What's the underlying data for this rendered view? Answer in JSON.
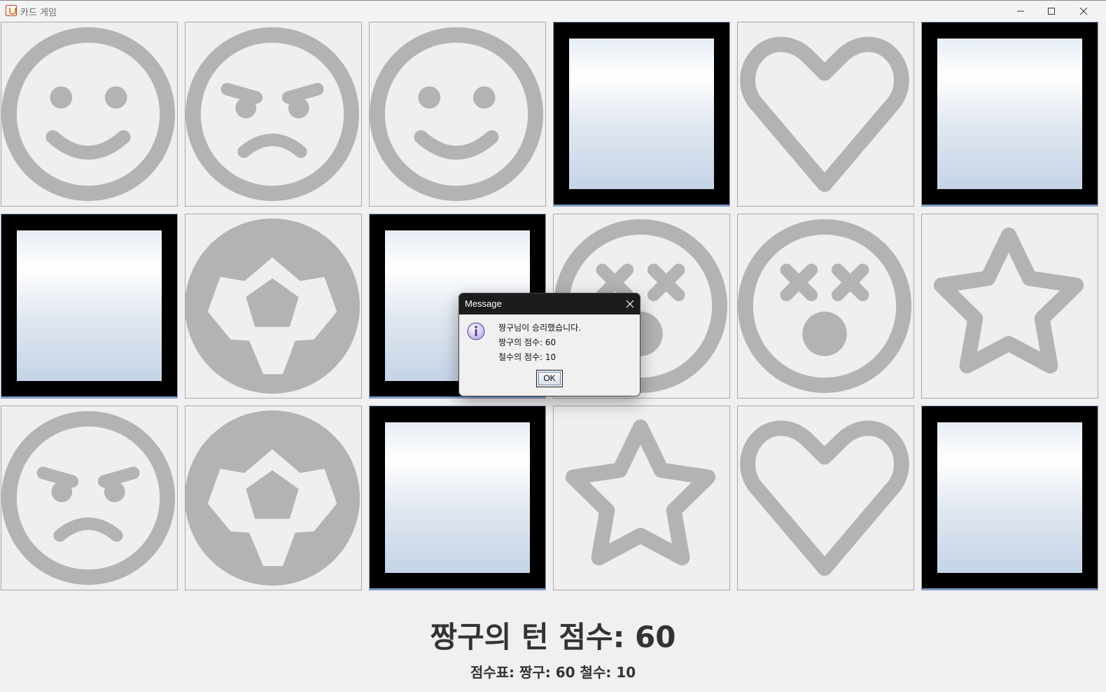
{
  "window": {
    "title": "카드 게임"
  },
  "cards": [
    {
      "state": "face",
      "icon": "smile-face-icon"
    },
    {
      "state": "face",
      "icon": "angry-face-icon"
    },
    {
      "state": "face",
      "icon": "smile-face-icon"
    },
    {
      "state": "back",
      "icon": "card-back"
    },
    {
      "state": "face",
      "icon": "heart-icon"
    },
    {
      "state": "back",
      "icon": "card-back"
    },
    {
      "state": "back",
      "icon": "card-back"
    },
    {
      "state": "face",
      "icon": "soccer-ball-icon"
    },
    {
      "state": "back",
      "icon": "card-back"
    },
    {
      "state": "face",
      "icon": "dizzy-face-icon"
    },
    {
      "state": "face",
      "icon": "dizzy-face-icon"
    },
    {
      "state": "face",
      "icon": "star-icon"
    },
    {
      "state": "face",
      "icon": "angry-face-icon"
    },
    {
      "state": "face",
      "icon": "soccer-ball-icon"
    },
    {
      "state": "back",
      "icon": "card-back"
    },
    {
      "state": "face",
      "icon": "star-icon"
    },
    {
      "state": "face",
      "icon": "heart-icon"
    },
    {
      "state": "back",
      "icon": "card-back"
    }
  ],
  "score": {
    "turn_text": "짱구의 턴 점수: 60",
    "board_text": "점수표: 짱구: 60 철수: 10"
  },
  "dialog": {
    "title": "Message",
    "line1": "짱구님이 승리했습니다.",
    "line2": "짱구의 점수: 60",
    "line3": "철수의 점수: 10",
    "ok_label": "OK"
  },
  "colors": {
    "icon_gray": "#b3b3b3",
    "card_face_bg": "#efefef",
    "card_back_frame": "#000000"
  }
}
